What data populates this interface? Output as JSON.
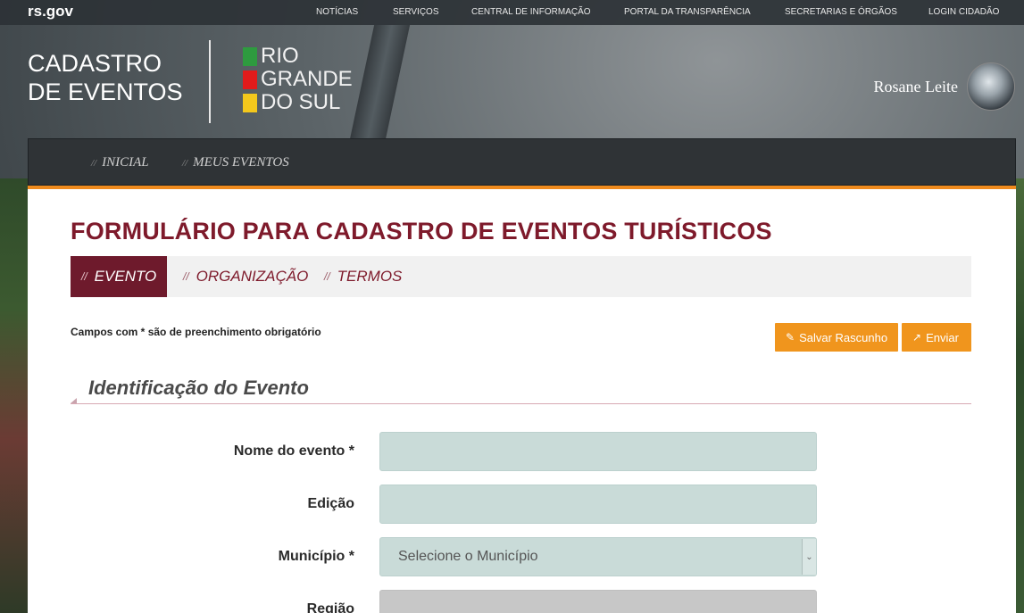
{
  "topbar": {
    "brand": "rs.gov",
    "links": [
      "NOTÍCIAS",
      "SERVIÇOS",
      "CENTRAL DE INFORMAÇÃO",
      "PORTAL DA TRANSPARÊNCIA",
      "SECRETARIAS E ÓRGÃOS",
      "LOGIN CIDADÃO"
    ]
  },
  "header": {
    "title_line1": "CADASTRO",
    "title_line2": "DE EVENTOS",
    "logo": [
      {
        "text": "RIO",
        "color": "#2e9b3f"
      },
      {
        "text": "GRANDE",
        "color": "#e21b1b"
      },
      {
        "text": "DO SUL",
        "color": "#f4c81c"
      }
    ],
    "user_name": "Rosane Leite"
  },
  "menu": {
    "items": [
      "INICIAL",
      "MEUS EVENTOS"
    ],
    "separator": "//"
  },
  "form": {
    "title": "FORMULÁRIO PARA CADASTRO DE EVENTOS TURÍSTICOS",
    "tabs": [
      {
        "label": "EVENTO",
        "active": true
      },
      {
        "label": "ORGANIZAÇÃO",
        "active": false
      },
      {
        "label": "TERMOS",
        "active": false
      }
    ],
    "required_note": "Campos com * são de preenchimento obrigatório",
    "buttons": {
      "save_draft": "Salvar Rascunho",
      "submit": "Enviar"
    },
    "section_title": "Identificação do Evento",
    "fields": [
      {
        "label": "Nome do evento *",
        "value": "",
        "type": "text"
      },
      {
        "label": "Edição",
        "value": "",
        "type": "text"
      },
      {
        "label": "Município *",
        "value": "Selecione o Município",
        "type": "select"
      },
      {
        "label": "Região",
        "value": "",
        "type": "disabled"
      }
    ]
  },
  "colors": {
    "accent_orange": "#f0951d",
    "brand_wine": "#7e1a2b",
    "field_bg": "#c9dbd8"
  }
}
